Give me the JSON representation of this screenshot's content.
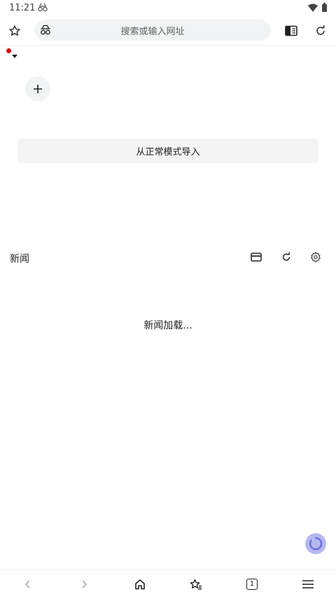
{
  "status_bar": {
    "time": "11:21",
    "icons": [
      "glasses-icon",
      "wifi-icon",
      "battery-icon"
    ]
  },
  "toolbar": {
    "search_placeholder": "搜索或输入网址",
    "icons": [
      "star-icon",
      "incognito-glasses-icon",
      "reader-mode-icon",
      "reload-icon"
    ]
  },
  "speed_dial": {
    "add_icon": "plus-icon"
  },
  "import_button": {
    "label": "从正常模式导入"
  },
  "news": {
    "title": "新闻",
    "loading_text": "新闻加载...",
    "icons": [
      "card-view-icon",
      "refresh-icon",
      "settings-gear-icon"
    ]
  },
  "bottom_bar": {
    "tab_count": "1",
    "icons": [
      "back-icon",
      "forward-icon",
      "home-icon",
      "bookmarks-icon",
      "tabs-icon",
      "menu-icon"
    ]
  },
  "colors": {
    "profile_dot": "#d50000",
    "fab": "#b5b8f2",
    "fab_icon": "#6a6fd9",
    "omnibox_bg": "#f1f3f4"
  }
}
